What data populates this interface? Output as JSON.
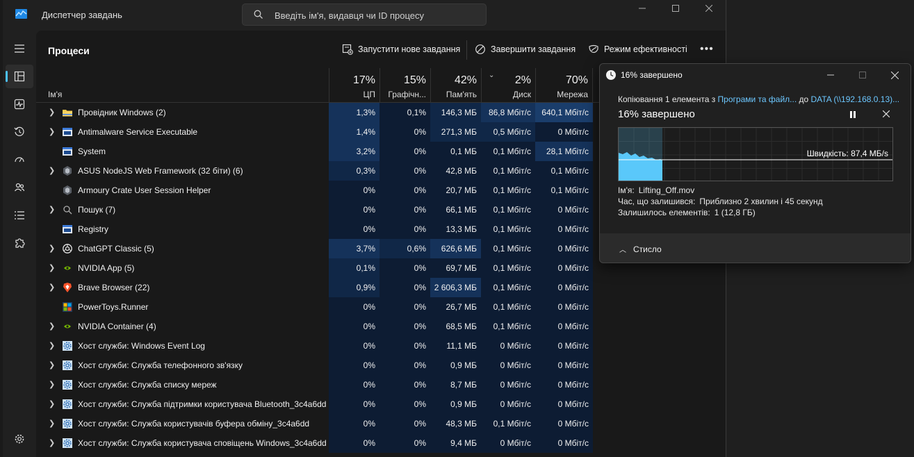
{
  "app": {
    "title": "Диспетчер завдань",
    "search_placeholder": "Введіть ім'я, видавця чи ID процесу",
    "page_title": "Процеси",
    "toolbar": {
      "run_task": "Запустити нове завдання",
      "end_task": "Завершити завдання",
      "efficiency": "Режим ефективності",
      "more": "•••"
    },
    "columns": {
      "name": "Ім'я",
      "cpu": {
        "pct": "17%",
        "label": "ЦП"
      },
      "gpu": {
        "pct": "15%",
        "label": "Графічн..."
      },
      "mem": {
        "pct": "42%",
        "label": "Пам'ять"
      },
      "disk": {
        "pct": "2%",
        "label": "Диск"
      },
      "net": {
        "pct": "70%",
        "label": "Мережа"
      }
    },
    "rows": [
      {
        "name": "Провідник Windows (2)",
        "expand": true,
        "icon": "folder-icon",
        "cpu": "1,3%",
        "gpu": "0,1%",
        "mem": "146,3 МБ",
        "disk": "86,8 Мбіт/с",
        "net": "640,1 Мбіт/с",
        "h": {
          "cpu": 2,
          "gpu": 0,
          "mem": 1,
          "disk": 2,
          "net": 3
        }
      },
      {
        "name": "Antimalware Service Executable",
        "expand": true,
        "icon": "app-window-icon",
        "cpu": "1,4%",
        "gpu": "0%",
        "mem": "271,3 МБ",
        "disk": "0,5 Мбіт/с",
        "net": "0 Мбіт/с",
        "h": {
          "cpu": 2,
          "gpu": 0,
          "mem": 1,
          "disk": 1,
          "net": 0
        }
      },
      {
        "name": "System",
        "expand": false,
        "icon": "app-window-icon",
        "cpu": "3,2%",
        "gpu": "0%",
        "mem": "0,1 МБ",
        "disk": "0,1 Мбіт/с",
        "net": "28,1 Мбіт/с",
        "h": {
          "cpu": 2,
          "gpu": 0,
          "mem": 0,
          "disk": 0,
          "net": 2
        }
      },
      {
        "name": "ASUS NodeJS Web Framework (32 біти) (6)",
        "expand": true,
        "icon": "asus-hex-icon",
        "cpu": "0,3%",
        "gpu": "0%",
        "mem": "42,8 МБ",
        "disk": "0,1 Мбіт/с",
        "net": "0,1 Мбіт/с",
        "h": {
          "cpu": 1,
          "gpu": 0,
          "mem": 0,
          "disk": 0,
          "net": 0
        }
      },
      {
        "name": "Armoury Crate User Session Helper",
        "expand": false,
        "icon": "asus-hex-icon",
        "cpu": "0%",
        "gpu": "0%",
        "mem": "20,7 МБ",
        "disk": "0,1 Мбіт/с",
        "net": "0,1 Мбіт/с",
        "h": {
          "cpu": 0,
          "gpu": 0,
          "mem": 0,
          "disk": 0,
          "net": 0
        }
      },
      {
        "name": "Пошук (7)",
        "expand": true,
        "icon": "search-icon",
        "cpu": "0%",
        "gpu": "0%",
        "mem": "66,1 МБ",
        "disk": "0,1 Мбіт/с",
        "net": "0 Мбіт/с",
        "h": {
          "cpu": 0,
          "gpu": 0,
          "mem": 0,
          "disk": 0,
          "net": 0
        }
      },
      {
        "name": "Registry",
        "expand": false,
        "icon": "app-window-icon",
        "cpu": "0%",
        "gpu": "0%",
        "mem": "13,3 МБ",
        "disk": "0,1 Мбіт/с",
        "net": "0 Мбіт/с",
        "h": {
          "cpu": 0,
          "gpu": 0,
          "mem": 0,
          "disk": 0,
          "net": 0
        }
      },
      {
        "name": "ChatGPT Classic (5)",
        "expand": true,
        "icon": "chatgpt-icon",
        "cpu": "3,7%",
        "gpu": "0,6%",
        "mem": "626,6 МБ",
        "disk": "0,1 Мбіт/с",
        "net": "0 Мбіт/с",
        "h": {
          "cpu": 2,
          "gpu": 1,
          "mem": 2,
          "disk": 0,
          "net": 0
        }
      },
      {
        "name": "NVIDIA App (5)",
        "expand": true,
        "icon": "nvidia-icon",
        "cpu": "0,1%",
        "gpu": "0%",
        "mem": "69,7 МБ",
        "disk": "0,1 Мбіт/с",
        "net": "0 Мбіт/с",
        "h": {
          "cpu": 1,
          "gpu": 0,
          "mem": 0,
          "disk": 0,
          "net": 0
        }
      },
      {
        "name": "Brave Browser (22)",
        "expand": true,
        "icon": "brave-icon",
        "cpu": "0,9%",
        "gpu": "0%",
        "mem": "2 606,3 МБ",
        "disk": "0,1 Мбіт/с",
        "net": "0 Мбіт/с",
        "h": {
          "cpu": 1,
          "gpu": 0,
          "mem": 2,
          "disk": 0,
          "net": 0
        }
      },
      {
        "name": "PowerToys.Runner",
        "expand": false,
        "icon": "powertoys-icon",
        "cpu": "0%",
        "gpu": "0%",
        "mem": "26,7 МБ",
        "disk": "0,1 Мбіт/с",
        "net": "0 Мбіт/с",
        "h": {
          "cpu": 0,
          "gpu": 0,
          "mem": 0,
          "disk": 0,
          "net": 0
        }
      },
      {
        "name": "NVIDIA Container (4)",
        "expand": true,
        "icon": "nvidia-icon",
        "cpu": "0%",
        "gpu": "0%",
        "mem": "68,5 МБ",
        "disk": "0,1 Мбіт/с",
        "net": "0 Мбіт/с",
        "h": {
          "cpu": 0,
          "gpu": 0,
          "mem": 0,
          "disk": 0,
          "net": 0
        }
      },
      {
        "name": "Хост служби: Windows Event Log",
        "expand": true,
        "icon": "service-gear-icon",
        "cpu": "0%",
        "gpu": "0%",
        "mem": "11,1 МБ",
        "disk": "0 Мбіт/с",
        "net": "0 Мбіт/с",
        "h": {
          "cpu": 0,
          "gpu": 0,
          "mem": 0,
          "disk": 0,
          "net": 0
        }
      },
      {
        "name": "Хост служби: Служба телефонного зв'язку",
        "expand": true,
        "icon": "service-gear-icon",
        "cpu": "0%",
        "gpu": "0%",
        "mem": "0,9 МБ",
        "disk": "0 Мбіт/с",
        "net": "0 Мбіт/с",
        "h": {
          "cpu": 0,
          "gpu": 0,
          "mem": 0,
          "disk": 0,
          "net": 0
        }
      },
      {
        "name": "Хост служби: Служба списку мереж",
        "expand": true,
        "icon": "service-gear-icon",
        "cpu": "0%",
        "gpu": "0%",
        "mem": "8,7 МБ",
        "disk": "0 Мбіт/с",
        "net": "0 Мбіт/с",
        "h": {
          "cpu": 0,
          "gpu": 0,
          "mem": 0,
          "disk": 0,
          "net": 0
        }
      },
      {
        "name": "Хост служби: Служба підтримки користувача Bluetooth_3c4a6dd",
        "expand": true,
        "icon": "service-gear-icon",
        "cpu": "0%",
        "gpu": "0%",
        "mem": "0,9 МБ",
        "disk": "0 Мбіт/с",
        "net": "0 Мбіт/с",
        "h": {
          "cpu": 0,
          "gpu": 0,
          "mem": 0,
          "disk": 0,
          "net": 0
        }
      },
      {
        "name": "Хост служби: Служба користувачів буфера обміну_3c4a6dd",
        "expand": true,
        "icon": "service-gear-icon",
        "cpu": "0%",
        "gpu": "0%",
        "mem": "48,3 МБ",
        "disk": "0,1 Мбіт/с",
        "net": "0 Мбіт/с",
        "h": {
          "cpu": 0,
          "gpu": 0,
          "mem": 0,
          "disk": 0,
          "net": 0
        }
      },
      {
        "name": "Хост служби: Служба користувача сповіщень Windows_3c4a6dd",
        "expand": true,
        "icon": "service-gear-icon",
        "cpu": "0%",
        "gpu": "0%",
        "mem": "9,4 МБ",
        "disk": "0 Мбіт/с",
        "net": "0 Мбіт/с",
        "h": {
          "cpu": 0,
          "gpu": 0,
          "mem": 0,
          "disk": 0,
          "net": 0
        }
      }
    ],
    "heat_colors": [
      "#0d1c33",
      "#102747",
      "#15325a",
      "#1a3d6b"
    ],
    "accent": "#4cc2ff"
  },
  "copy_dialog": {
    "title": "16% завершено",
    "desc_prefix": "Копіювання 1 елемента з ",
    "desc_source": "Програми та файл...",
    "desc_mid": " до ",
    "desc_dest": "DATA (\\\\192.168.0.13)...",
    "status": "16% завершено",
    "progress_fraction": 0.16,
    "speed": "Швидкість: 87,4 МБ/s",
    "name_label": "Ім'я:",
    "name_value": "Lifting_Off.mov",
    "time_label": "Час, що залишився:",
    "time_value": "Приблизно 2 хвилин і 45 секунд",
    "items_label": "Залишилось елементів:",
    "items_value": "1 (12,8 ГБ)",
    "less_details": "Стисло",
    "graph_color": "#5ac8fa"
  }
}
